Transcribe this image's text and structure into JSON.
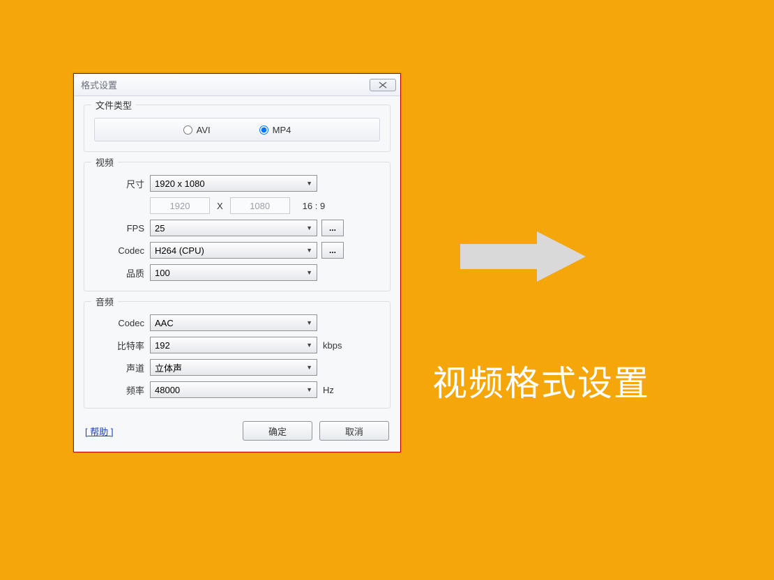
{
  "dialog": {
    "title": "格式设置",
    "close_glyph": "✕"
  },
  "file_type": {
    "label": "文件类型",
    "opt_avi": "AVI",
    "opt_mp4": "MP4"
  },
  "video": {
    "label": "视频",
    "size_label": "尺寸",
    "size_value": "1920 x 1080",
    "width": "1920",
    "height": "1080",
    "x_sep": "X",
    "ratio": "16 : 9",
    "fps_label": "FPS",
    "fps_value": "25",
    "codec_label": "Codec",
    "codec_value": "H264 (CPU)",
    "quality_label": "品质",
    "quality_value": "100",
    "dots": "..."
  },
  "audio": {
    "label": "音频",
    "codec_label": "Codec",
    "codec_value": "AAC",
    "bitrate_label": "比特率",
    "bitrate_value": "192",
    "bitrate_unit": "kbps",
    "channel_label": "声道",
    "channel_value": "立体声",
    "freq_label": "频率",
    "freq_value": "48000",
    "freq_unit": "Hz"
  },
  "footer": {
    "help": "[ 帮助 ]",
    "ok": "确定",
    "cancel": "取消"
  },
  "caption": "视频格式设置"
}
